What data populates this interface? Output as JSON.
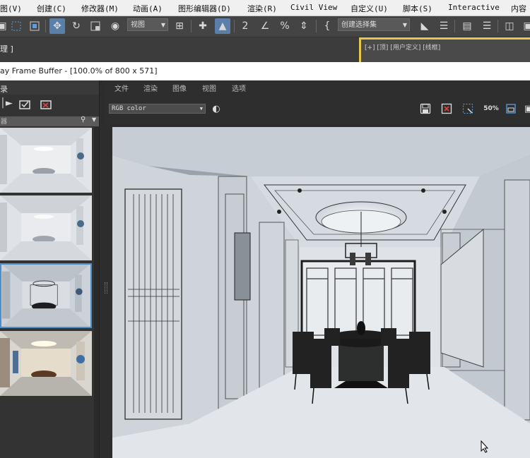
{
  "menubar": {
    "items": [
      {
        "label": "图(V)"
      },
      {
        "label": "创建(C)"
      },
      {
        "label": "修改器(M)"
      },
      {
        "label": "动画(A)"
      },
      {
        "label": "图形编辑器(D)"
      },
      {
        "label": "渲染(R)"
      },
      {
        "label": "Civil View"
      },
      {
        "label": "自定义(U)"
      },
      {
        "label": "脚本(S)"
      },
      {
        "label": "Interactive"
      },
      {
        "label": "内容"
      }
    ]
  },
  "toolbar": {
    "view_combo": "视图",
    "selection_set_combo": "创建选择集"
  },
  "strip2": {
    "left_label": "理 ]",
    "viewport_label": "[+] [顶] [用户定义] [线框]"
  },
  "vfb": {
    "title": "ay Frame Buffer - [100.0% of 800 x 571]",
    "menu": [
      "文件",
      "渲染",
      "图像",
      "视图",
      "选项"
    ],
    "channel": "RGB color",
    "zoom_label": "50%"
  },
  "left_panel": {
    "header": "录",
    "filter_placeholder": "器"
  },
  "icons": {
    "move": "move-icon",
    "rotate": "rotate-icon",
    "save": "save-icon",
    "clear": "clear-icon",
    "region": "region-render-icon"
  },
  "colors": {
    "accent_blue": "#4d8fc8",
    "viewport_border": "#e6c84a"
  }
}
